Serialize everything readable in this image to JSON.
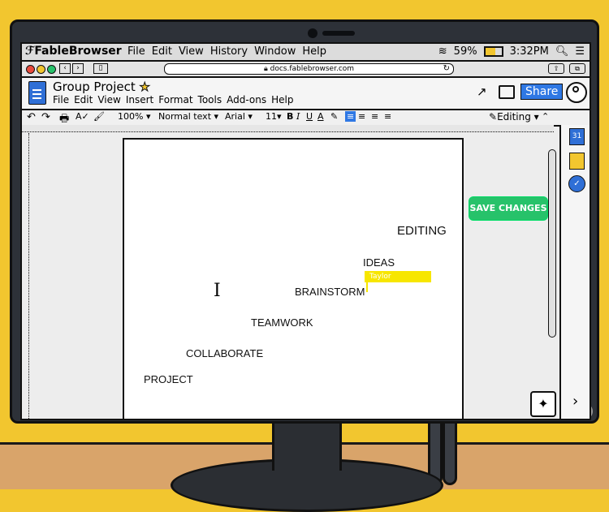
{
  "os": {
    "app_name": "FableBrowser",
    "menus": [
      "File",
      "Edit",
      "View",
      "History",
      "Window",
      "Help"
    ],
    "battery": "59%",
    "time": "3:32PM"
  },
  "browser": {
    "url": "docs.fablebrowser.com"
  },
  "doc": {
    "title": "Group Project",
    "menus": [
      "File",
      "Edit",
      "View",
      "Insert",
      "Format",
      "Tools",
      "Add-ons",
      "Help"
    ],
    "share_label": "Share"
  },
  "toolbar": {
    "zoom": "100%",
    "style": "Normal text",
    "font": "Arial",
    "size": "11",
    "mode": "Editing"
  },
  "page_words": {
    "editing": "EDITING",
    "ideas": "IDEAS",
    "brainstorm": "BRAINSTORM",
    "teamwork": "TEAMWORK",
    "collaborate": "COLLABORATE",
    "project": "PROJECT"
  },
  "collaborator": {
    "name": "Taylor",
    "color": "#f7e600"
  },
  "side_panel": {
    "calendar_day": "31"
  },
  "actions": {
    "save_changes": "SAVE CHANGES"
  },
  "colors": {
    "accent": "#2f78e4",
    "save": "#27c26a",
    "wall": "#f2c62f"
  }
}
